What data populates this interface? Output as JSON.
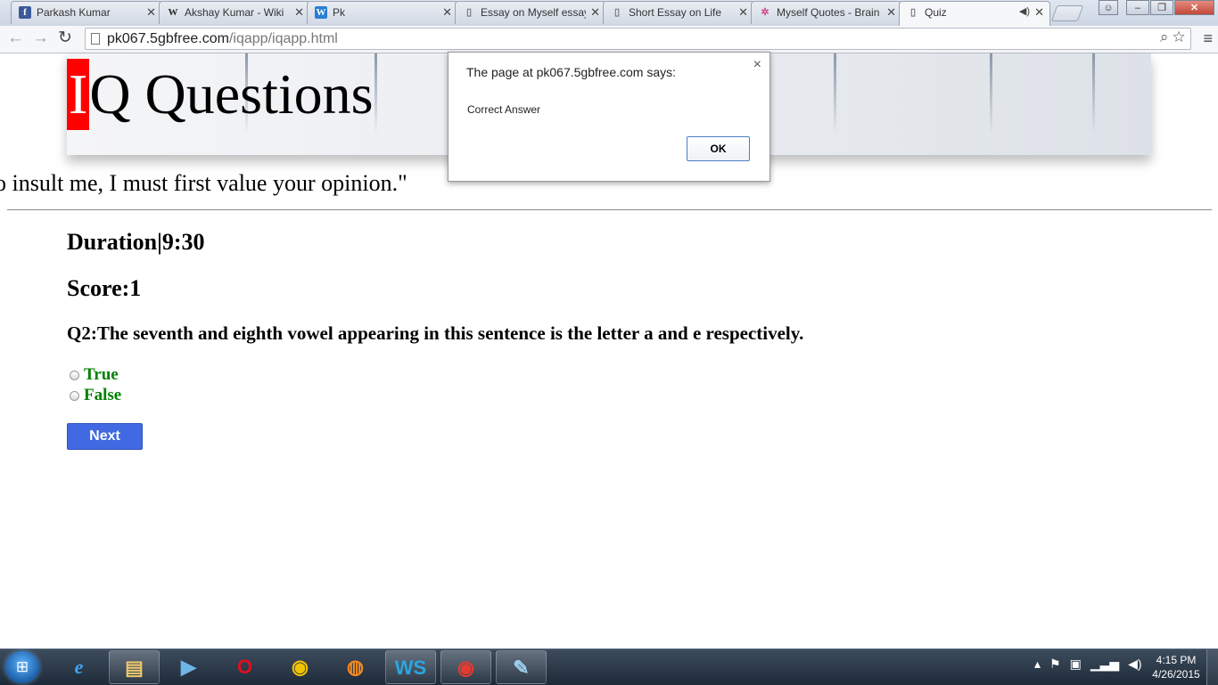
{
  "browser": {
    "tabs": [
      {
        "title": "Parkash Kumar",
        "icon": "facebook-icon",
        "active": false
      },
      {
        "title": "Akshay Kumar - Wiki",
        "icon": "wikipedia-icon",
        "active": false
      },
      {
        "title": "Pk",
        "icon": "site-icon",
        "active": false
      },
      {
        "title": "Essay on Myself essay",
        "icon": "page-icon",
        "active": false
      },
      {
        "title": "Short Essay on Life",
        "icon": "page-icon",
        "active": false
      },
      {
        "title": "Myself Quotes - Brain",
        "icon": "pinwheel-icon",
        "active": false
      },
      {
        "title": "Quiz",
        "icon": "page-icon",
        "active": true
      }
    ],
    "url_domain": "pk067.5gbfree.com",
    "url_path": "/iqapp/iqapp.html"
  },
  "page": {
    "site_title_first": "I",
    "site_title_rest": "Q Questions",
    "scrolling_quote": "o insult me, I must first value your opinion.\"",
    "duration": "Duration|9:30",
    "score": "Score:1",
    "question": "Q2:The seventh and eighth vowel appearing in this sentence is the letter a and e respectively.",
    "options": [
      "True",
      "False"
    ],
    "next_label": "Next"
  },
  "dialog": {
    "title": "The page at pk067.5gbfree.com says:",
    "message": "Correct Answer",
    "ok_label": "OK",
    "close_glyph": "×"
  },
  "taskbar": {
    "apps": [
      "internet-explorer",
      "file-explorer",
      "media-player",
      "opera",
      "chrome",
      "firefox",
      "webstorm",
      "chrome-running",
      "paint"
    ],
    "time": "4:15 PM",
    "date": "4/26/2015"
  },
  "colors": {
    "title_highlight": "#ff0000",
    "option_text": "#008000",
    "next_button": "#4169e1"
  }
}
